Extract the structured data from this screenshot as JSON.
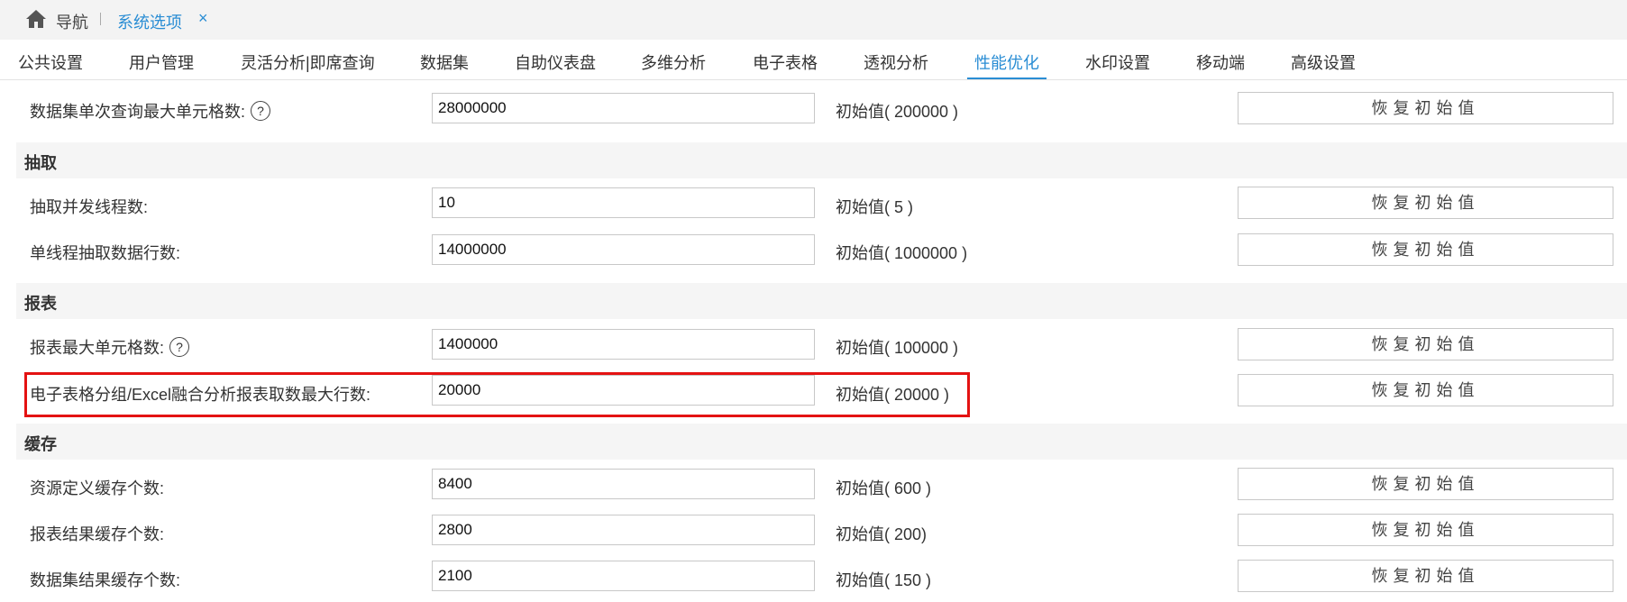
{
  "nav": {
    "home_label": "导航",
    "active_tab": "系统选项",
    "close_symbol": "×"
  },
  "tabs": [
    {
      "label": "公共设置"
    },
    {
      "label": "用户管理"
    },
    {
      "label": "灵活分析|即席查询"
    },
    {
      "label": "数据集"
    },
    {
      "label": "自助仪表盘"
    },
    {
      "label": "多维分析"
    },
    {
      "label": "电子表格"
    },
    {
      "label": "透视分析"
    },
    {
      "label": "性能优化"
    },
    {
      "label": "水印设置"
    },
    {
      "label": "移动端"
    },
    {
      "label": "高级设置"
    }
  ],
  "active_tab_index": 8,
  "reset_label": "恢复初始值",
  "sections": {
    "extract": "抽取",
    "report": "报表",
    "cache": "缓存"
  },
  "rows": [
    {
      "label": "数据集单次查询最大单元格数:",
      "value": "28000000",
      "default": "初始值( 200000 )",
      "help": true
    },
    {
      "label": "抽取并发线程数:",
      "value": "10",
      "default": "初始值( 5 )"
    },
    {
      "label": "单线程抽取数据行数:",
      "value": "14000000",
      "default": "初始值( 1000000 )"
    },
    {
      "label": "报表最大单元格数:",
      "value": "1400000",
      "default": "初始值( 100000 )",
      "help": true
    },
    {
      "label": "电子表格分组/Excel融合分析报表取数最大行数:",
      "value": "20000",
      "default": "初始值( 20000 )",
      "highlighted": true
    },
    {
      "label": "资源定义缓存个数:",
      "value": "8400",
      "default": "初始值( 600 )"
    },
    {
      "label": "报表结果缓存个数:",
      "value": "2800",
      "default": "初始值( 200)"
    },
    {
      "label": "数据集结果缓存个数:",
      "value": "2100",
      "default": "初始值( 150 )"
    }
  ],
  "help_symbol": "?",
  "colors": {
    "accent": "#2a8dd4",
    "highlight_border": "#e41212",
    "section_bg": "#f5f5f5"
  },
  "icons": {
    "home": "home-icon",
    "help": "question-circle-icon",
    "close": "close-icon"
  }
}
